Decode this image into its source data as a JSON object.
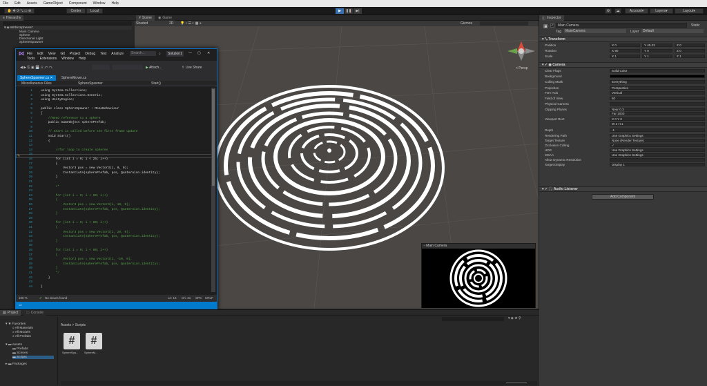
{
  "menu": [
    "File",
    "Edit",
    "Assets",
    "GameObject",
    "Component",
    "Window",
    "Help"
  ],
  "toolbar": {
    "center": "Center",
    "local": "Local",
    "account": "Account",
    "layers": "Layers",
    "layout": "Layout"
  },
  "hierarchy": {
    "tab": "Hierarchy",
    "scene": "WithinSpheres*",
    "items": [
      "Main Camera",
      "Sphere",
      "Directional Light",
      "SphereSpawner"
    ]
  },
  "scene": {
    "tab_scene": "Scene",
    "tab_game": "Game",
    "shading": "Shaded",
    "mode": "2D",
    "gizmos": "Gizmos",
    "persp": "< Persp"
  },
  "camera_preview": {
    "title": "Main Camera"
  },
  "vs": {
    "menu1": [
      "File",
      "Edit",
      "View",
      "Git",
      "Project",
      "Debug",
      "Test",
      "Analyze"
    ],
    "menu2": [
      "Tools",
      "Extensions",
      "Window",
      "Help"
    ],
    "search": "Search...",
    "solution": "Solution1",
    "attach": "Attach...",
    "live_share": "Live Share",
    "tab_active": "SphereSpawner.cs",
    "tab_other": "SphereMover.cs",
    "nav_left": "Miscellaneous Files",
    "nav_mid": "SphereSpawner",
    "nav_right": "Start()",
    "zoom": "100 %",
    "issues": "No issues found",
    "ln": "Ln: 16",
    "ch": "Ch: 31",
    "spc": "SPC",
    "crlf": "CRLF"
  },
  "code": [
    {
      "n": "1",
      "t": "using System.Collections;"
    },
    {
      "n": "2",
      "t": "using System.Collections.Generic;"
    },
    {
      "n": "3",
      "t": "using UnityEngine;"
    },
    {
      "n": "4",
      "t": ""
    },
    {
      "n": "5",
      "t": "public class SphereSpawner : MonoBehaviour"
    },
    {
      "n": "6",
      "t": "{"
    },
    {
      "n": "7",
      "t": "    //Need reference to a sphere"
    },
    {
      "n": "8",
      "t": "    public GameObject spherePrefab;"
    },
    {
      "n": "9",
      "t": ""
    },
    {
      "n": "10",
      "t": "    // Start is called before the first frame update"
    },
    {
      "n": "11",
      "t": "    void Start()"
    },
    {
      "n": "12",
      "t": "    {"
    },
    {
      "n": "13",
      "t": ""
    },
    {
      "n": "14",
      "t": "        //for loop to create spheres"
    },
    {
      "n": "15",
      "t": ""
    },
    {
      "n": "16",
      "t": "        for (int i = 0; i < 25; i++)"
    },
    {
      "n": "17",
      "t": "        {"
    },
    {
      "n": "18",
      "t": "            Vector3 pos = new Vector3(i, 0, 0);"
    },
    {
      "n": "19",
      "t": "            Instantiate(spherePrefab, pos, Quaternion.identity);"
    },
    {
      "n": "20",
      "t": "        }"
    },
    {
      "n": "21",
      "t": ""
    },
    {
      "n": "22",
      "t": "        /*"
    },
    {
      "n": "23",
      "t": ""
    },
    {
      "n": "24",
      "t": "        for (int i = 0; i < 80; i++)"
    },
    {
      "n": "25",
      "t": "        {"
    },
    {
      "n": "26",
      "t": "            Vector3 pos = new Vector3(i, 10, 0);"
    },
    {
      "n": "27",
      "t": "            Instantiate(spherePrefab, pos, Quaternion.identity);"
    },
    {
      "n": "28",
      "t": "        }"
    },
    {
      "n": "29",
      "t": ""
    },
    {
      "n": "30",
      "t": "        for (int i = 0; i < 80; i++)"
    },
    {
      "n": "31",
      "t": "        {"
    },
    {
      "n": "32",
      "t": "            Vector3 pos = new Vector3(i, 20, 0);"
    },
    {
      "n": "33",
      "t": "            Instantiate(spherePrefab, pos, Quaternion.identity);"
    },
    {
      "n": "34",
      "t": "        }"
    },
    {
      "n": "35",
      "t": ""
    },
    {
      "n": "36",
      "t": "        for (int i = 0; i < 80; i++)"
    },
    {
      "n": "37",
      "t": "        {"
    },
    {
      "n": "38",
      "t": "            Vector3 pos = new Vector3(i, -10, 0);"
    },
    {
      "n": "39",
      "t": "            Instantiate(spherePrefab, pos, Quaternion.identity);"
    },
    {
      "n": "40",
      "t": "        }"
    },
    {
      "n": "41",
      "t": "        */"
    },
    {
      "n": "42",
      "t": "    }"
    },
    {
      "n": "43",
      "t": ""
    },
    {
      "n": "44",
      "t": "}"
    }
  ],
  "inspector": {
    "tab": "Inspector",
    "object_name": "Main Camera",
    "static": "Static",
    "tag_label": "Tag",
    "tag": "MainCamera",
    "layer_label": "Layer",
    "layer": "Default",
    "transform": "Transform",
    "position": "Position",
    "rotation": "Rotation",
    "scale": "Scale",
    "pos": {
      "x": "0",
      "y": "45.23",
      "z": "0"
    },
    "rot": {
      "x": "90",
      "y": "0",
      "z": "0"
    },
    "scl": {
      "x": "1",
      "y": "1",
      "z": "1"
    },
    "camera": "Camera",
    "rows": [
      {
        "l": "Clear Flags",
        "v": "Solid Color"
      },
      {
        "l": "Background",
        "v": ""
      },
      {
        "l": "Culling Mask",
        "v": "Everything"
      },
      {
        "l": "Projection",
        "v": "Perspective"
      },
      {
        "l": "FOV Axis",
        "v": "Vertical"
      },
      {
        "l": "Field of View",
        "v": "60"
      },
      {
        "l": "Physical Camera",
        "v": ""
      },
      {
        "l": "Clipping Planes",
        "v": "Near 0.3"
      },
      {
        "l": "",
        "v": "Far 1000"
      },
      {
        "l": "Viewport Rect",
        "v": "X 0     Y 0"
      },
      {
        "l": "",
        "v": "W 1     H 1"
      },
      {
        "l": "Depth",
        "v": "-1"
      },
      {
        "l": "Rendering Path",
        "v": "Use Graphics Settings"
      },
      {
        "l": "Target Texture",
        "v": "None (Render Texture)"
      },
      {
        "l": "Occlusion Culling",
        "v": "✓"
      },
      {
        "l": "HDR",
        "v": "Use Graphics Settings"
      },
      {
        "l": "MSAA",
        "v": "Use Graphics Settings"
      },
      {
        "l": "Allow Dynamic Resolution",
        "v": ""
      },
      {
        "l": "Target Display",
        "v": "Display 1"
      }
    ],
    "audio": "Audio Listener",
    "add_component": "Add Component"
  },
  "project": {
    "tab_project": "Project",
    "tab_console": "Console",
    "tree": [
      "Favorites",
      "All Materials",
      "All Models",
      "All Prefabs",
      "Assets",
      "Prefabs",
      "Scenes",
      "Scripts",
      "Packages"
    ],
    "breadcrumb": "Assets > Scripts",
    "files": [
      "SphereSpa...",
      "SphereM..."
    ]
  },
  "colors": {
    "accent": "#0e70c0",
    "vs_blue": "#007acc",
    "unity_dark": "#282828"
  }
}
